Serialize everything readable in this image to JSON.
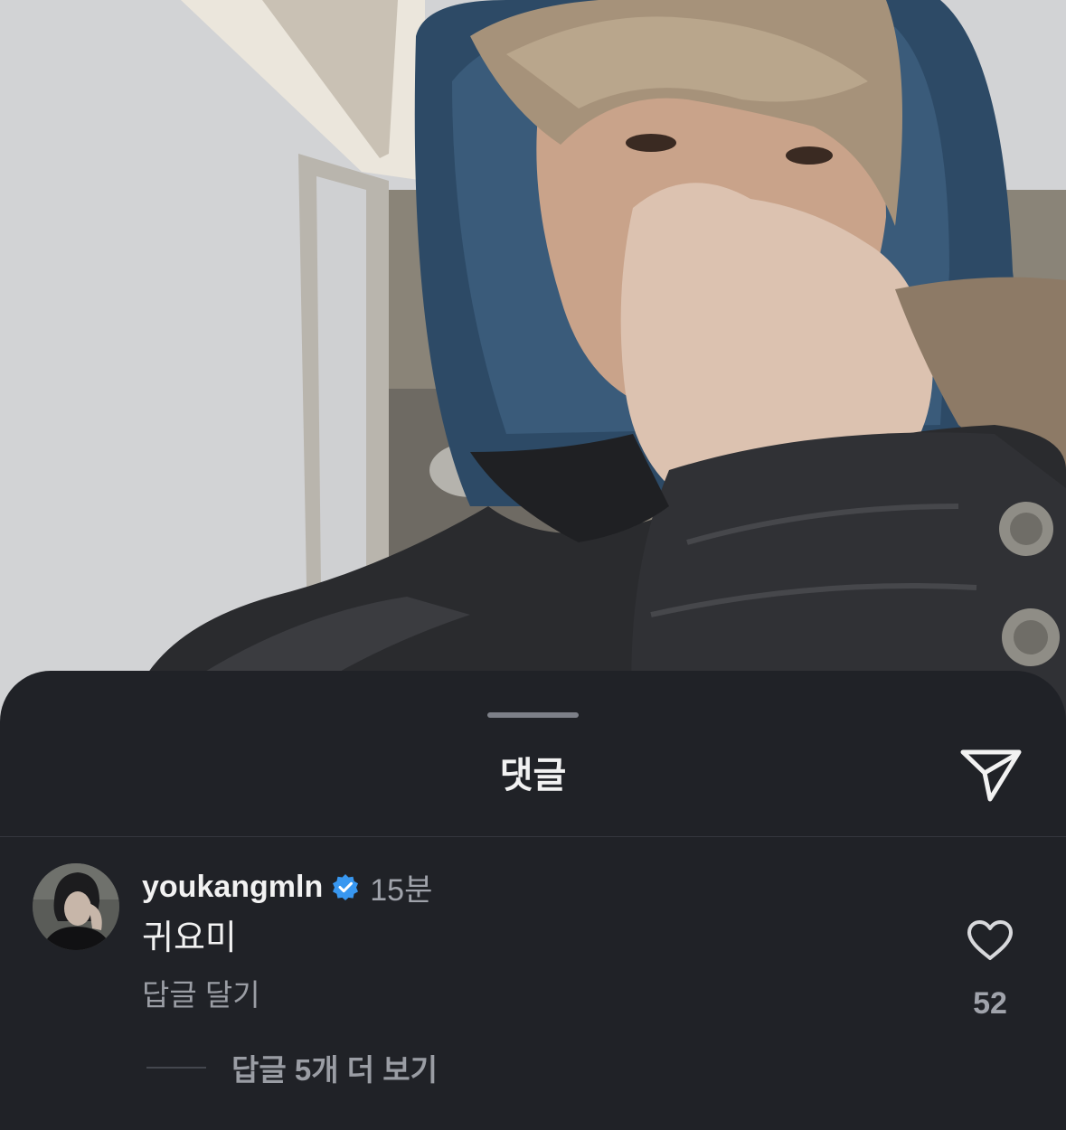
{
  "sheet": {
    "title": "댓글",
    "share_icon": "paper-plane-icon"
  },
  "comment": {
    "username": "youkangmln",
    "verified_icon": "verified-badge-icon",
    "time": "15분",
    "text": "귀요미",
    "reply_label": "답글 달기",
    "like_icon": "heart-outline-icon",
    "like_count": "52",
    "view_more_replies": "답글 5개 더 보기"
  },
  "colors": {
    "sheet_background": "#202227",
    "primary_text": "#f2f2f2",
    "secondary_text": "#9a9da4",
    "verified_blue": "#3897f0"
  }
}
